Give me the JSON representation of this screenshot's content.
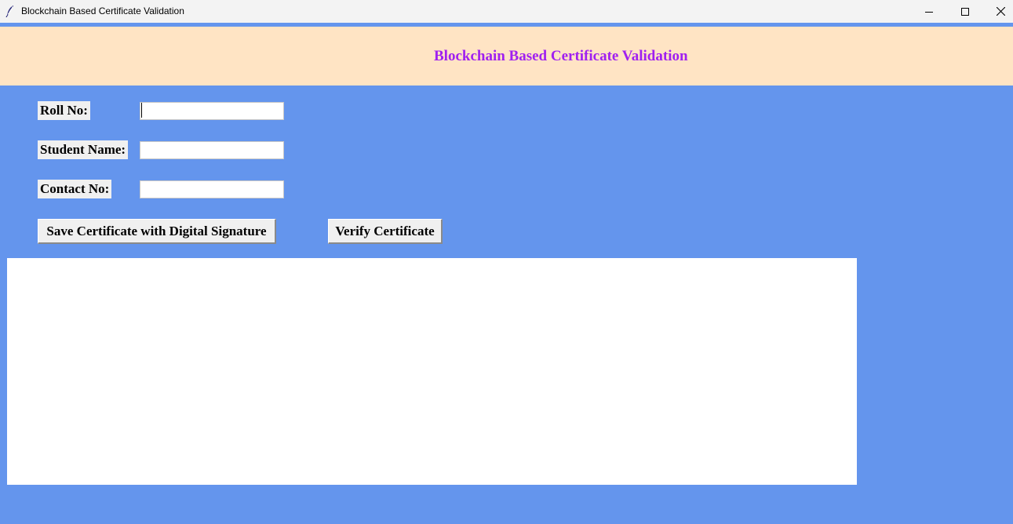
{
  "window": {
    "title": "Blockchain Based Certificate Validation",
    "icon": "feather-icon"
  },
  "header": {
    "title": "Blockchain Based Certificate Validation"
  },
  "form": {
    "roll_no_label": "Roll No:",
    "roll_no_value": "",
    "student_name_label": "Student Name:",
    "student_name_value": "",
    "contact_no_label": "Contact No:",
    "contact_no_value": ""
  },
  "actions": {
    "save_label": "Save Certificate with Digital Signature",
    "verify_label": "Verify Certificate"
  },
  "output": {
    "text": ""
  },
  "colors": {
    "background": "#6495ED",
    "header_background": "#FFE4C4",
    "header_text": "#A020F0",
    "label_background": "#F0F0F0"
  }
}
